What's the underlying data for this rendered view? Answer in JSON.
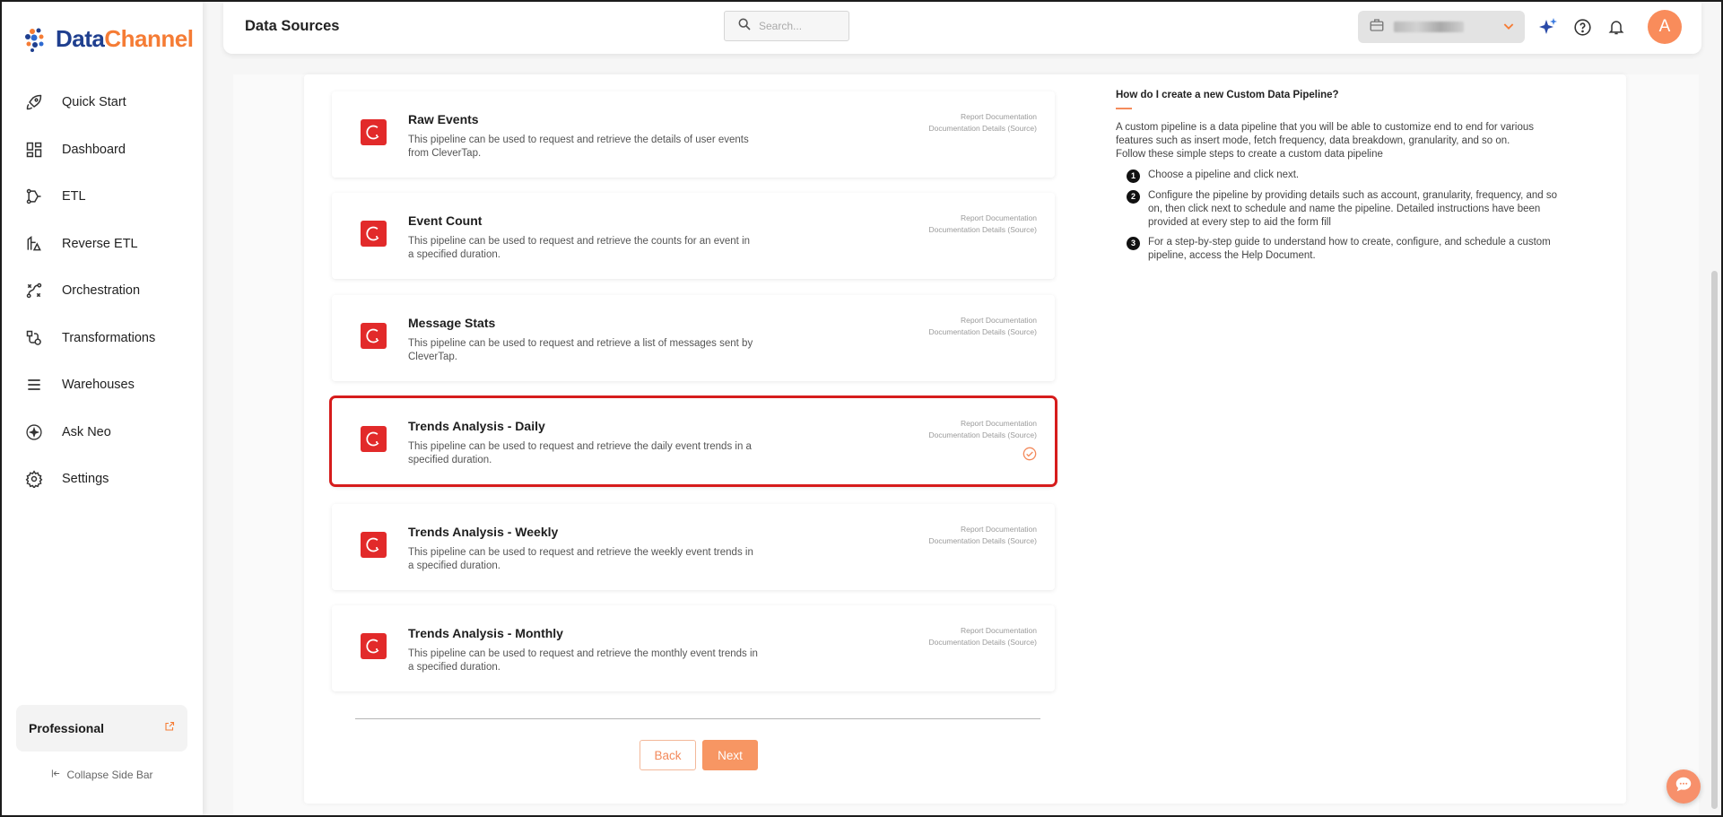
{
  "app": {
    "brand_part1": "Data",
    "brand_part2": "Channel",
    "accent_color": "#f79663",
    "brand_blue": "#1f3f8f"
  },
  "sidebar": {
    "items": [
      {
        "label": "Quick Start",
        "icon": "rocket-icon"
      },
      {
        "label": "Dashboard",
        "icon": "dashboard-grid-icon"
      },
      {
        "label": "ETL",
        "icon": "etl-flow-icon"
      },
      {
        "label": "Reverse ETL",
        "icon": "reverse-etl-icon"
      },
      {
        "label": "Orchestration",
        "icon": "orchestration-icon"
      },
      {
        "label": "Transformations",
        "icon": "transformations-icon"
      },
      {
        "label": "Warehouses",
        "icon": "warehouse-stack-icon"
      },
      {
        "label": "Ask Neo",
        "icon": "sparkle-circle-icon"
      },
      {
        "label": "Settings",
        "icon": "gear-icon"
      }
    ],
    "plan_label": "Professional",
    "collapse_label": "Collapse Side Bar"
  },
  "header": {
    "title": "Data Sources",
    "search_placeholder": "Search...",
    "avatar_initial": "A"
  },
  "pipelines": [
    {
      "title": "Raw Events",
      "desc": "This pipeline can be used to request and retrieve the details of user events from CleverTap.",
      "link1": "Report Documentation",
      "link2": "Documentation Details (Source)",
      "selected": false
    },
    {
      "title": "Event Count",
      "desc": "This pipeline can be used to request and retrieve the counts for an event in a specified duration.",
      "link1": "Report Documentation",
      "link2": "Documentation Details (Source)",
      "selected": false
    },
    {
      "title": "Message Stats",
      "desc": "This pipeline can be used to request and retrieve a list of messages sent by CleverTap.",
      "link1": "Report Documentation",
      "link2": "Documentation Details (Source)",
      "selected": false
    },
    {
      "title": "Trends Analysis - Daily",
      "desc": "This pipeline can be used to request and retrieve the daily event trends in a specified duration.",
      "link1": "Report Documentation",
      "link2": "Documentation Details (Source)",
      "selected": true
    },
    {
      "title": "Trends Analysis - Weekly",
      "desc": "This pipeline can be used to request and retrieve the weekly event trends in a specified duration.",
      "link1": "Report Documentation",
      "link2": "Documentation Details (Source)",
      "selected": false
    },
    {
      "title": "Trends Analysis - Monthly",
      "desc": "This pipeline can be used to request and retrieve the monthly event trends in a specified duration.",
      "link1": "Report Documentation",
      "link2": "Documentation Details (Source)",
      "selected": false
    }
  ],
  "buttons": {
    "back": "Back",
    "next": "Next"
  },
  "help": {
    "title": "How do I create a new Custom Data Pipeline?",
    "intro": "A custom pipeline is a data pipeline that you will be able to customize end to end for various features such as insert mode, fetch frequency, data breakdown, granularity, and so on.",
    "intro2": "Follow these simple steps to create a custom data pipeline",
    "steps": [
      {
        "num": "1",
        "text": "Choose a pipeline and click next."
      },
      {
        "num": "2",
        "text": "Configure the pipeline by providing details such as account, granularity, frequency, and so on, then click next to schedule and name the pipeline. Detailed instructions have been provided at every step to aid the form fill"
      },
      {
        "num": "3",
        "text": "For a step-by-step guide to understand how to create, configure, and schedule a custom pipeline, access the Help Document."
      }
    ]
  }
}
